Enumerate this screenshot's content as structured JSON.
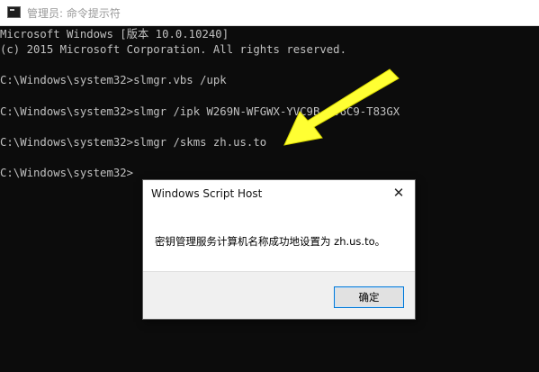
{
  "window": {
    "title": "管理员: 命令提示符"
  },
  "console": {
    "lines": [
      "Microsoft Windows [版本 10.0.10240]",
      "(c) 2015 Microsoft Corporation. All rights reserved.",
      "",
      "C:\\Windows\\system32>slmgr.vbs /upk",
      "",
      "C:\\Windows\\system32>slmgr /ipk W269N-WFGWX-YVC9B-4J6C9-T83GX",
      "",
      "C:\\Windows\\system32>slmgr /skms zh.us.to",
      "",
      "C:\\Windows\\system32>"
    ]
  },
  "dialog": {
    "title": "Windows Script Host",
    "close_glyph": "✕",
    "message": "密钥管理服务计算机名称成功地设置为 zh.us.to。",
    "ok_label": "确定"
  },
  "annotation": {
    "arrow_color": "#ffff33"
  }
}
